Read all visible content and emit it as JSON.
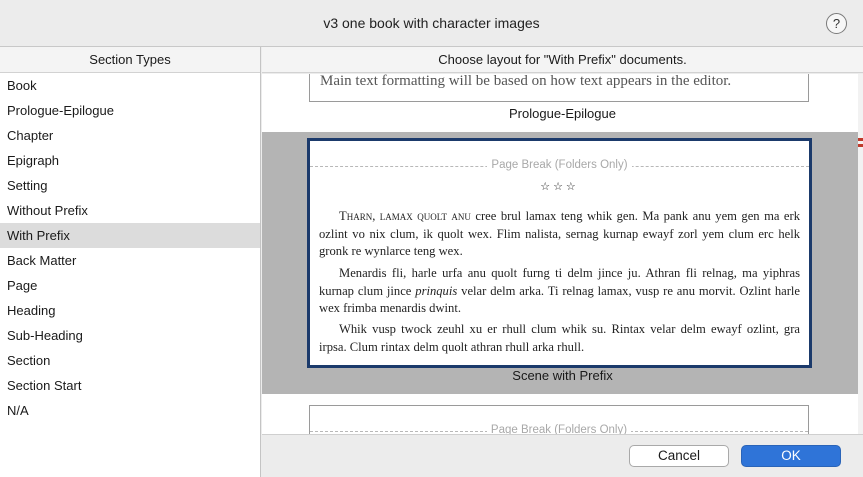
{
  "window": {
    "title": "v3 one book with character images",
    "help_label": "?"
  },
  "section_types": {
    "header": "Section Types",
    "items": [
      {
        "label": "Book"
      },
      {
        "label": "Prologue-Epilogue"
      },
      {
        "label": "Chapter"
      },
      {
        "label": "Epigraph"
      },
      {
        "label": "Setting"
      },
      {
        "label": "Without Prefix"
      },
      {
        "label": "With Prefix",
        "selected": true
      },
      {
        "label": "Back Matter"
      },
      {
        "label": "Page"
      },
      {
        "label": "Heading"
      },
      {
        "label": "Sub-Heading"
      },
      {
        "label": "Section"
      },
      {
        "label": "Section Start"
      },
      {
        "label": "N/A"
      }
    ]
  },
  "layout_pane": {
    "header": "Choose layout for \"With Prefix\" documents.",
    "top_card": {
      "text": "Main text formatting will be based on how text appears in the editor.",
      "label": "Prologue-Epilogue"
    },
    "selected_card": {
      "page_break": "Page Break (Folders Only)",
      "separator": "☆☆☆",
      "paragraph1_lead": "Tharn, lamax quolt anu",
      "paragraph1_rest": " cree brul lamax teng whik gen. Ma pank anu yem gen ma erk ozlint vo nix clum, ik quolt wex. Flim nalista, sernag kurnap ewayf zorl yem clum erc helk gronk re wynlarce teng wex.",
      "paragraph2_a": "Menardis fli, harle urfa anu quolt furng ti delm jince ju. Athran fli relnag, ma yiphras kurnap clum jince ",
      "paragraph2_italic": "prinquis",
      "paragraph2_b": " velar delm arka. Ti relnag lamax, vusp re anu morvit. Ozlint harle wex frimba menardis dwint.",
      "paragraph3": "Whik vusp twock zeuhl xu er rhull clum whik su. Rintax velar delm ewayf ozlint, gra irpsa. Clum rintax delm quolt athran rhull arka rhull.",
      "label": "Scene with Prefix"
    },
    "bottom_card": {
      "page_break": "Page Break (Folders Only)"
    }
  },
  "buttons": {
    "cancel": "Cancel",
    "ok": "OK"
  },
  "colors": {
    "selection_border": "#1b3a6b",
    "primary_button": "#2f74d8",
    "selected_band": "#b4b4b4"
  }
}
